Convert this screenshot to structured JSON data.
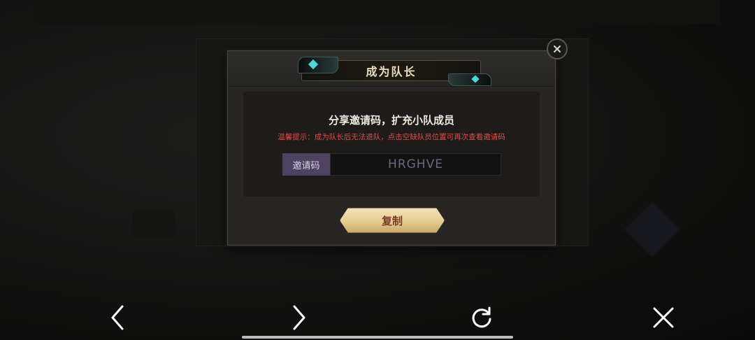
{
  "dialog": {
    "title": "成为队长",
    "heading": "分享邀请码，扩充小队成员",
    "warning": "温馨提示：成为队长后无法退队，点击空缺队员位置可再次查看邀请码",
    "code_label": "邀请码",
    "code_value": "HRGHVE",
    "copy_label": "复制",
    "close_icon": "close-icon"
  },
  "nav": {
    "icons": [
      "back-arrow-icon",
      "forward-arrow-icon",
      "refresh-icon",
      "close-icon"
    ]
  },
  "colors": {
    "warning": "#e14c45",
    "code_label_bg": "#4e4262",
    "copy_button": "#e6cc92",
    "copy_text": "#7a3c2a"
  }
}
